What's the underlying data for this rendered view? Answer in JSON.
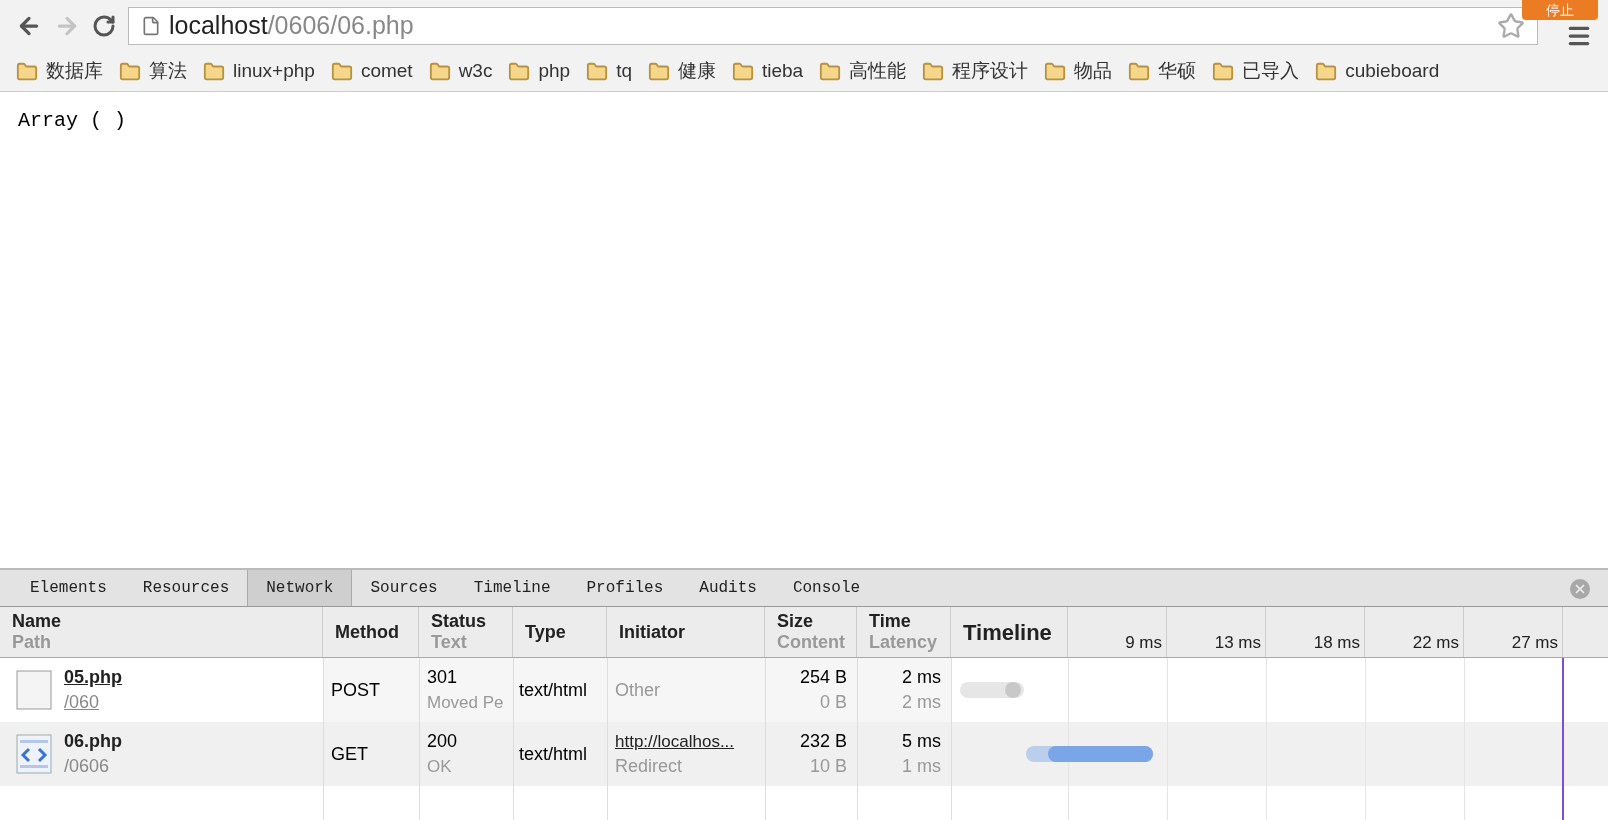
{
  "toolbar": {
    "back_enabled": true,
    "forward_enabled": false,
    "address_host": "localhost",
    "address_path": "/0606/06.php",
    "stop_button": "停止"
  },
  "bookmarks": [
    "数据库",
    "算法",
    "linux+php",
    "comet",
    "w3c",
    "php",
    "tq",
    "健康",
    "tieba",
    "高性能",
    "程序设计",
    "物品",
    "华硕",
    "已导入",
    "cubieboard"
  ],
  "page": {
    "text": "Array ( )"
  },
  "devtools": {
    "tabs": [
      {
        "label": "Elements",
        "selected": false
      },
      {
        "label": "Resources",
        "selected": false
      },
      {
        "label": "Network",
        "selected": true
      },
      {
        "label": "Sources",
        "selected": false
      },
      {
        "label": "Timeline",
        "selected": false
      },
      {
        "label": "Profiles",
        "selected": false
      },
      {
        "label": "Audits",
        "selected": false
      },
      {
        "label": "Console",
        "selected": false
      }
    ],
    "columns": [
      {
        "title": "Name",
        "subtitle": "Path"
      },
      {
        "title": "Method"
      },
      {
        "title": "Status",
        "subtitle": "Text"
      },
      {
        "title": "Type"
      },
      {
        "title": "Initiator"
      },
      {
        "title": "Size",
        "subtitle": "Content"
      },
      {
        "title": "Time",
        "subtitle": "Latency"
      },
      {
        "title": "Timeline"
      }
    ],
    "ticks": [
      "9 ms",
      "13 ms",
      "18 ms",
      "22 ms",
      "27 ms"
    ],
    "rows": [
      {
        "kind": "document",
        "name": "05.php",
        "path": "/060",
        "hovered": true,
        "method": "POST",
        "status": "301",
        "status_text": "Moved Pe",
        "type": "text/html",
        "initiator": "Other",
        "initiator_link": false,
        "size": "254 B",
        "content": "0 B",
        "time": "2 ms",
        "latency": "2 ms",
        "color": "#c8c8c8"
      },
      {
        "kind": "html",
        "name": "06.php",
        "path": "/0606",
        "hovered": false,
        "method": "GET",
        "status": "200",
        "status_text": "OK",
        "type": "text/html",
        "initiator": "http://localhos...",
        "initiator_detail": "Redirect",
        "initiator_link": true,
        "size": "232 B",
        "content": "10 B",
        "time": "5 ms",
        "latency": "1 ms",
        "color": "#7aa5e6"
      }
    ]
  }
}
